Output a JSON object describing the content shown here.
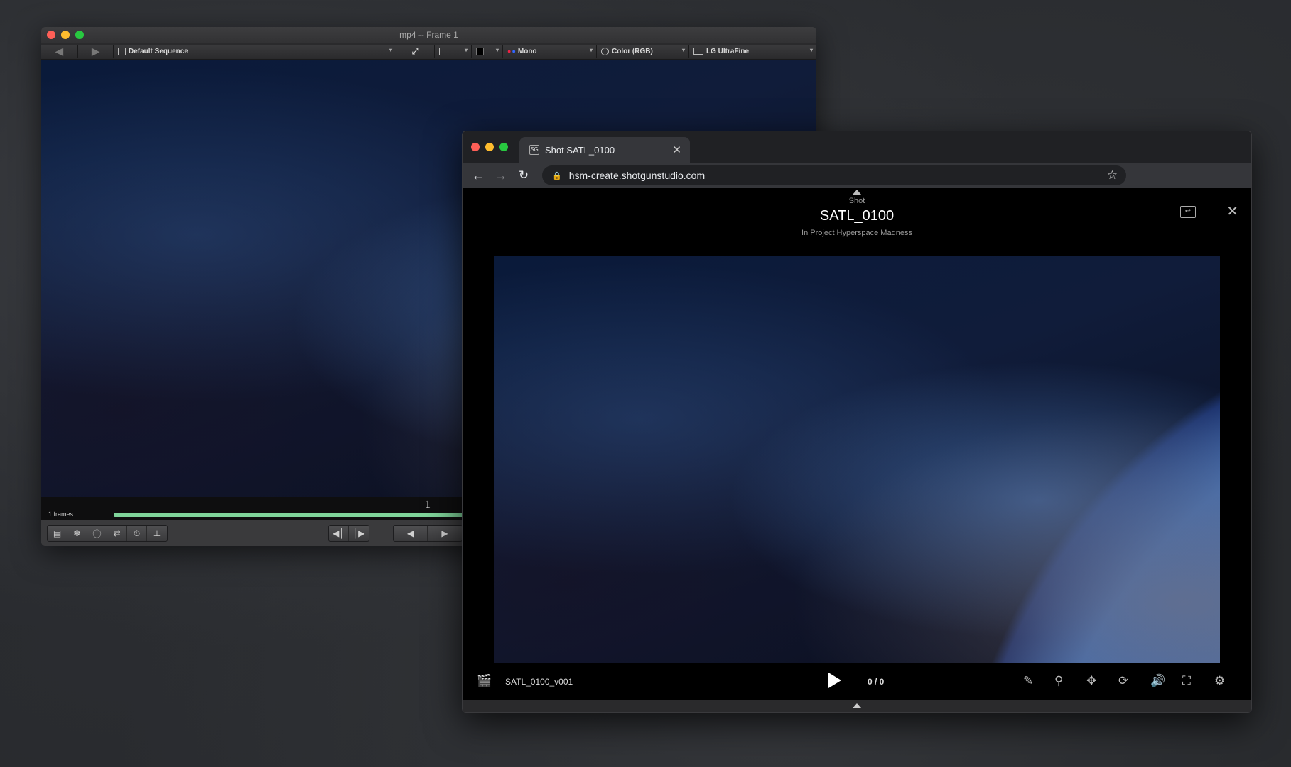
{
  "rv_window": {
    "title": "mp4 -- Frame 1",
    "toolbar": {
      "sequence": "Default Sequence",
      "channel": "Mono",
      "color_space": "Color (RGB)",
      "display": "LG UltraFine"
    },
    "timeline": {
      "frames_label": "1 frames",
      "frame_number": "1"
    }
  },
  "browser": {
    "tab_title": "Shot SATL_0100",
    "url": "hsm-create.shotgunstudio.com",
    "shot": {
      "kind": "Shot",
      "name": "SATL_0100",
      "project": "In Project Hyperspace Madness"
    },
    "player": {
      "version_name": "SATL_0100_v001",
      "frame_counter": "0 / 0"
    }
  },
  "colors": {
    "timeline_bar": "#7fd49a",
    "traffic_red": "#fe5f57",
    "traffic_yellow": "#febc2e",
    "traffic_green": "#28c840"
  }
}
